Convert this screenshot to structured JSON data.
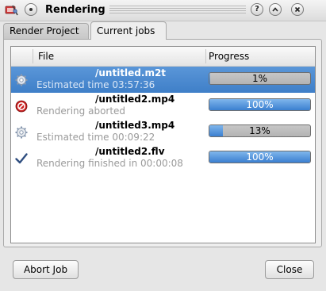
{
  "window": {
    "title": "Rendering",
    "buttons": {
      "help": "?",
      "shade": "^",
      "close": "X"
    }
  },
  "tabs": [
    {
      "label": "Render Project",
      "active": false
    },
    {
      "label": "Current jobs",
      "active": true
    }
  ],
  "list": {
    "columns": [
      "File",
      "Progress"
    ],
    "jobs": [
      {
        "file": "/untitled.m2t",
        "status": "Estimated time 03:57:36",
        "progress": 1,
        "progress_label": "1%",
        "icon": "gear-icon",
        "selected": true
      },
      {
        "file": "/untitled2.mp4",
        "status": "Rendering aborted",
        "progress": 100,
        "progress_label": "100%",
        "icon": "stop-icon",
        "selected": false
      },
      {
        "file": "/untitled3.mp4",
        "status": "Estimated time 00:09:22",
        "progress": 13,
        "progress_label": "13%",
        "icon": "gear-icon",
        "selected": false
      },
      {
        "file": "/untitled2.flv",
        "status": "Rendering finished in 00:00:08",
        "progress": 100,
        "progress_label": "100%",
        "icon": "checkmark-icon",
        "selected": false
      }
    ]
  },
  "footer": {
    "abort_label": "Abort Job",
    "close_label": "Close"
  },
  "colors": {
    "selection": "#3f7fc8",
    "progress_fill": "#3b7fd0",
    "error": "#cc2020"
  }
}
